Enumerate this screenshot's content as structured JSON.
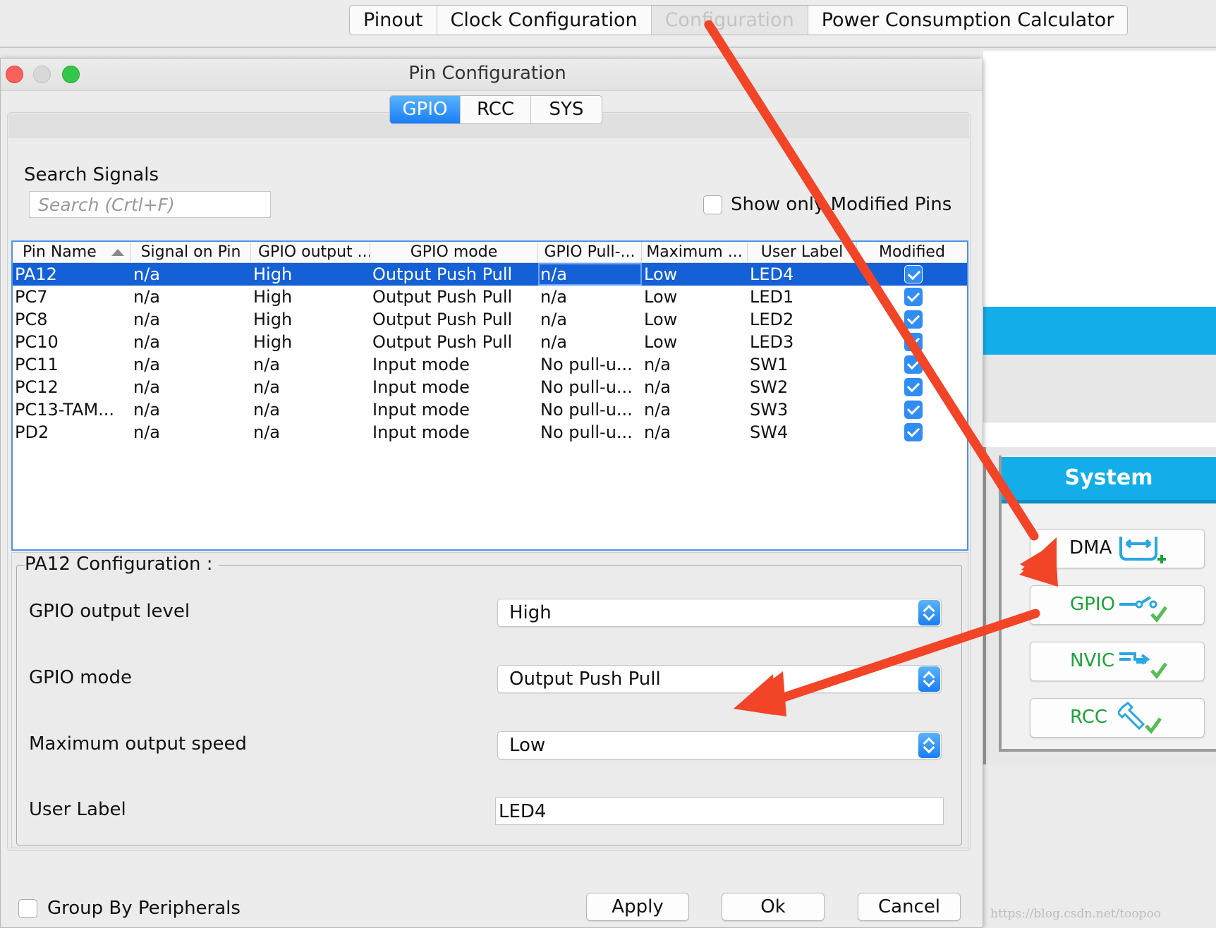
{
  "main_tabs": [
    {
      "label": "Pinout"
    },
    {
      "label": "Clock Configuration"
    },
    {
      "label": "Configuration"
    },
    {
      "label": "Power Consumption Calculator"
    }
  ],
  "dialog": {
    "title": "Pin Configuration",
    "tabs": [
      {
        "label": "GPIO"
      },
      {
        "label": "RCC"
      },
      {
        "label": "SYS"
      }
    ],
    "search": {
      "label": "Search Signals",
      "placeholder": "Search (Crtl+F)"
    },
    "show_only_modified": {
      "label": "Show only Modified Pins",
      "checked": false
    },
    "table": {
      "columns": [
        "Pin Name",
        "Signal on Pin",
        "GPIO output ...",
        "GPIO mode",
        "GPIO Pull-...",
        "Maximum ...",
        "User Label",
        "Modified"
      ],
      "sorted_column": "Pin Name",
      "rows": [
        {
          "pin": "PA12",
          "signal": "n/a",
          "output": "High",
          "mode": "Output Push Pull",
          "pull": "n/a",
          "speed": "Low",
          "label": "LED4",
          "modified": true
        },
        {
          "pin": "PC7",
          "signal": "n/a",
          "output": "High",
          "mode": "Output Push Pull",
          "pull": "n/a",
          "speed": "Low",
          "label": "LED1",
          "modified": true
        },
        {
          "pin": "PC8",
          "signal": "n/a",
          "output": "High",
          "mode": "Output Push Pull",
          "pull": "n/a",
          "speed": "Low",
          "label": "LED2",
          "modified": true
        },
        {
          "pin": "PC10",
          "signal": "n/a",
          "output": "High",
          "mode": "Output Push Pull",
          "pull": "n/a",
          "speed": "Low",
          "label": "LED3",
          "modified": true
        },
        {
          "pin": "PC11",
          "signal": "n/a",
          "output": "n/a",
          "mode": "Input mode",
          "pull": "No pull-u...",
          "speed": "n/a",
          "label": "SW1",
          "modified": true
        },
        {
          "pin": "PC12",
          "signal": "n/a",
          "output": "n/a",
          "mode": "Input mode",
          "pull": "No pull-u...",
          "speed": "n/a",
          "label": "SW2",
          "modified": true
        },
        {
          "pin": "PC13-TAM...",
          "signal": "n/a",
          "output": "n/a",
          "mode": "Input mode",
          "pull": "No pull-u...",
          "speed": "n/a",
          "label": "SW3",
          "modified": true
        },
        {
          "pin": "PD2",
          "signal": "n/a",
          "output": "n/a",
          "mode": "Input mode",
          "pull": "No pull-u...",
          "speed": "n/a",
          "label": "SW4",
          "modified": true
        }
      ]
    },
    "config": {
      "title": "PA12 Configuration :",
      "fields": [
        {
          "label": "GPIO output level",
          "value": "High"
        },
        {
          "label": "GPIO mode",
          "value": "Output Push Pull"
        },
        {
          "label": "Maximum output speed",
          "value": "Low"
        },
        {
          "label": "User Label",
          "value": "LED4"
        }
      ]
    },
    "group_by_peripherals": {
      "label": "Group By Peripherals",
      "checked": false
    },
    "buttons": {
      "apply": "Apply",
      "ok": "Ok",
      "cancel": "Cancel"
    }
  },
  "system_panel": {
    "header": "System",
    "items": [
      {
        "label": "DMA",
        "icon": "dma-icon"
      },
      {
        "label": "GPIO",
        "icon": "gpio-icon"
      },
      {
        "label": "NVIC",
        "icon": "nvic-icon"
      },
      {
        "label": "RCC",
        "icon": "rcc-icon"
      }
    ]
  },
  "watermark": "https://blog.csdn.net/toopoo",
  "colors": {
    "accent_blue": "#13aee9",
    "selection": "#1460d6",
    "annotation_arrow": "#f24427",
    "ok_green": "#1ba33a"
  }
}
